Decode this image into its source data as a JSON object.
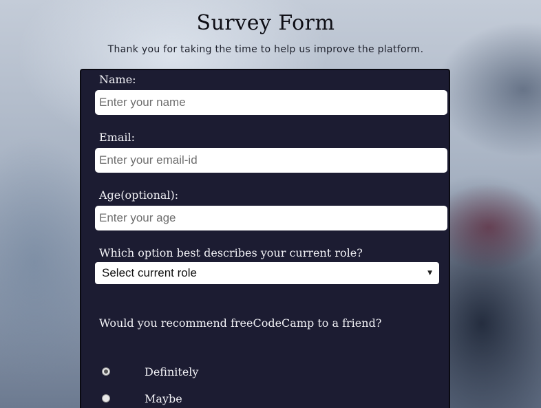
{
  "header": {
    "title": "Survey Form",
    "description": "Thank you for taking the time to help us improve the platform."
  },
  "form": {
    "name": {
      "label": "Name:",
      "placeholder": "Enter your name",
      "value": ""
    },
    "email": {
      "label": "Email:",
      "placeholder": "Enter your email-id",
      "value": ""
    },
    "age": {
      "label": "Age(optional):",
      "placeholder": "Enter your age",
      "value": ""
    },
    "role": {
      "label": "Which option best describes your current role?",
      "selected": "Select current role"
    },
    "recommend": {
      "question": "Would you recommend freeCodeCamp to a friend?",
      "options": [
        {
          "label": "Definitely",
          "checked": true
        },
        {
          "label": "Maybe",
          "checked": false
        }
      ]
    }
  },
  "colors": {
    "form_background": "#1c1c32",
    "form_text": "#f2f2f6",
    "title_text": "#0d0d14"
  },
  "icons": {
    "select_chevron": "chevron-down-icon"
  }
}
